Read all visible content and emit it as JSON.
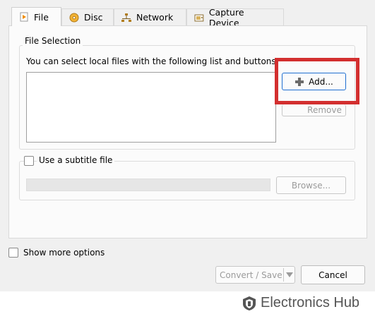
{
  "tabs": [
    {
      "label": "File",
      "icon": "file-media-icon"
    },
    {
      "label": "Disc",
      "icon": "disc-icon"
    },
    {
      "label": "Network",
      "icon": "network-icon"
    },
    {
      "label": "Capture Device",
      "icon": "capture-device-icon"
    }
  ],
  "file_selection": {
    "legend": "File Selection",
    "description": "You can select local files with the following list and buttons.",
    "add_label": "Add...",
    "remove_label": "Remove"
  },
  "subtitle": {
    "checkbox_label": "Use a subtitle file",
    "browse_label": "Browse..."
  },
  "show_more_options_label": "Show more options",
  "footer": {
    "convert_save_label": "Convert / Save",
    "cancel_label": "Cancel"
  },
  "watermark": {
    "text": "Electronics Hub"
  },
  "colors": {
    "highlight_box": "#d32f2f",
    "focus_border": "#1f6fd1"
  }
}
